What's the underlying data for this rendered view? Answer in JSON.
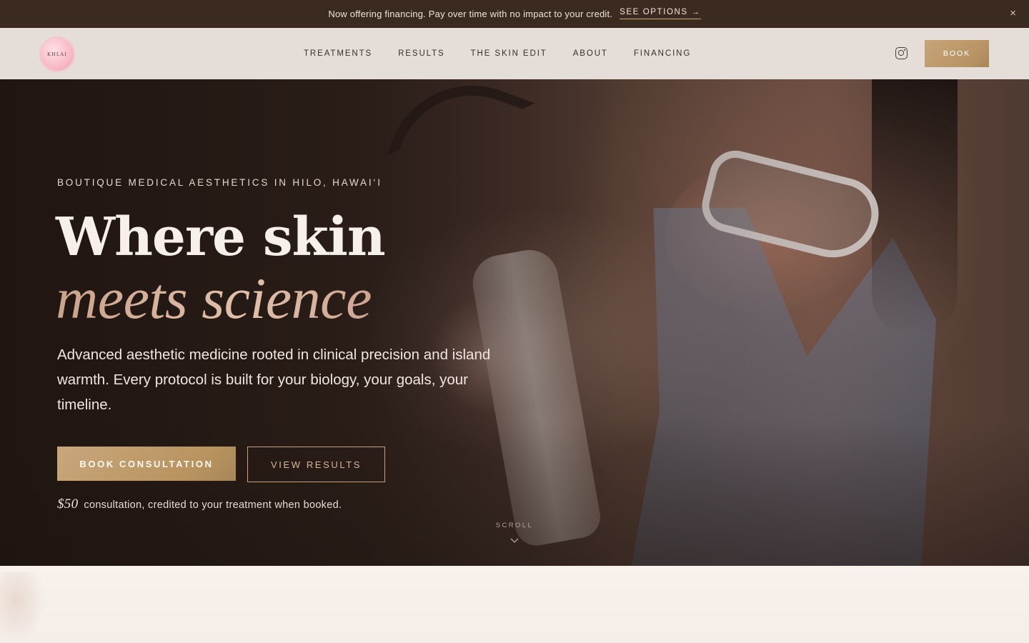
{
  "announcement": {
    "message": "Now offering financing. Pay over time with no impact to your credit.",
    "link_label": "SEE OPTIONS →",
    "close_glyph": "×"
  },
  "header": {
    "logo_text": "KHLAI",
    "nav": [
      {
        "label": "TREATMENTS"
      },
      {
        "label": "RESULTS"
      },
      {
        "label": "THE SKIN EDIT"
      },
      {
        "label": "ABOUT"
      },
      {
        "label": "FINANCING"
      }
    ],
    "social_icon": "instagram-icon",
    "book_label": "BOOK"
  },
  "hero": {
    "eyebrow": "BOUTIQUE MEDICAL AESTHETICS IN HILO, HAWAI‘I",
    "headline_line1": "Where skin",
    "headline_line2": "meets science",
    "lead": "Advanced aesthetic medicine rooted in clinical precision and island warmth. Every protocol is built for your biology, your goals, your timeline.",
    "primary_cta": "BOOK CONSULTATION",
    "secondary_cta": "VIEW RESULTS",
    "fine_price": "$50",
    "fine_text": "consultation, credited to your treatment when booked.",
    "scroll_label": "SCROLL"
  },
  "colors": {
    "accent_gold": "#c4a074",
    "announcement_bg": "#3a2a20",
    "header_bg": "#e4ddd8",
    "headline_italic": "#d4ad96"
  }
}
